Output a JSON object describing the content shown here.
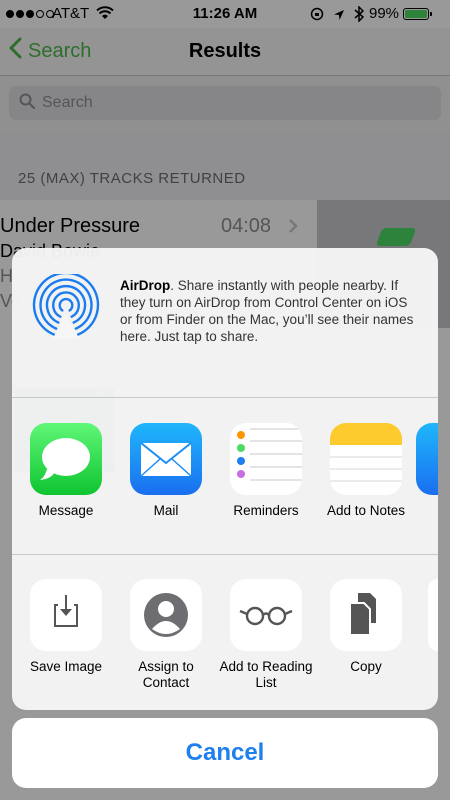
{
  "status_bar": {
    "carrier": "AT&T",
    "time": "11:26 AM",
    "battery": "99%",
    "battery_level": 0.99
  },
  "nav": {
    "back_label": "Search",
    "title": "Results"
  },
  "search": {
    "placeholder": "Search"
  },
  "section_header": "25 (MAX) TRACKS RETURNED",
  "track": {
    "title": "Under Pressure",
    "duration": "04:08",
    "artist": "David Bowie",
    "line3": "H",
    "line4": "Vo"
  },
  "airdrop": {
    "title": "AirDrop",
    "description": ". Share instantly with people nearby. If they turn on AirDrop from Control Center on iOS or from Finder on the Mac, you’ll see their names here. Just tap to share."
  },
  "apps": [
    "Message",
    "Mail",
    "Reminders",
    "Add to Notes"
  ],
  "actions": [
    "Save Image",
    "Assign to Contact",
    "Add to Reading List",
    "Copy"
  ],
  "cancel_label": "Cancel",
  "colors": {
    "accent_green": "#4cb848",
    "link_blue": "#1e7ff0",
    "airdrop_blue": "#1b7cf0"
  }
}
